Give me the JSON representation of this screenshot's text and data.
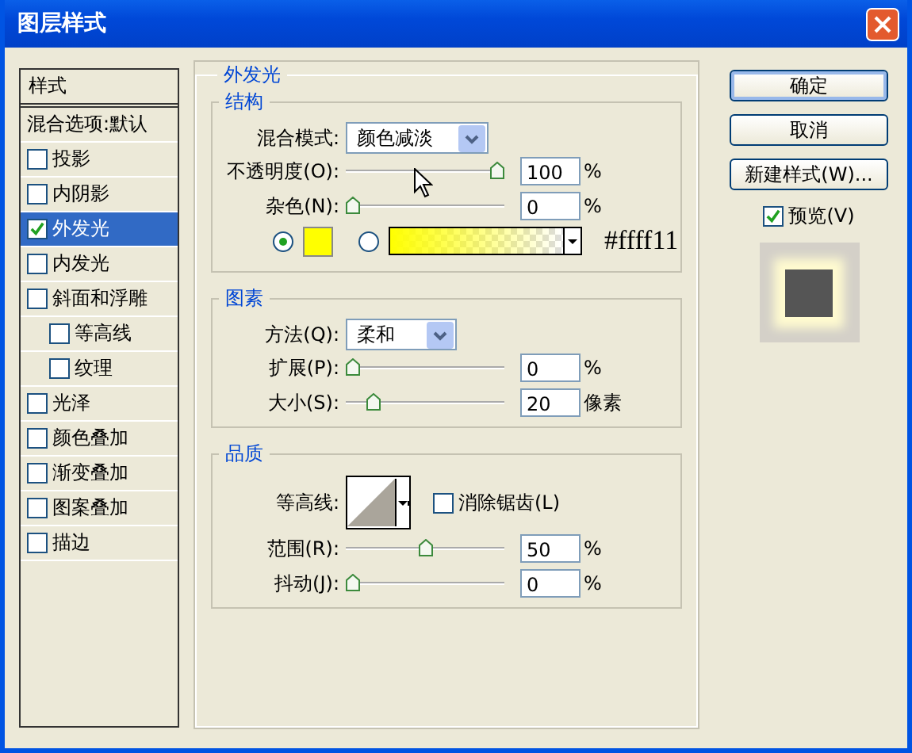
{
  "window": {
    "title": "图层样式"
  },
  "styles_list": {
    "header": "样式",
    "blend_options": "混合选项:默认",
    "items": [
      {
        "label": "投影",
        "checked": false,
        "selected": false
      },
      {
        "label": "内阴影",
        "checked": false,
        "selected": false
      },
      {
        "label": "外发光",
        "checked": true,
        "selected": true
      },
      {
        "label": "内发光",
        "checked": false,
        "selected": false
      },
      {
        "label": "斜面和浮雕",
        "checked": false,
        "selected": false,
        "children": [
          {
            "label": "等高线",
            "checked": false,
            "selected": false
          },
          {
            "label": "纹理",
            "checked": false,
            "selected": false
          }
        ]
      },
      {
        "label": "光泽",
        "checked": false,
        "selected": false
      },
      {
        "label": "颜色叠加",
        "checked": false,
        "selected": false
      },
      {
        "label": "渐变叠加",
        "checked": false,
        "selected": false
      },
      {
        "label": "图案叠加",
        "checked": false,
        "selected": false
      },
      {
        "label": "描边",
        "checked": false,
        "selected": false
      }
    ]
  },
  "outer_glow": {
    "title": "外发光",
    "structure": {
      "title": "结构",
      "blend_mode": {
        "label": "混合模式:",
        "value": "颜色减淡"
      },
      "opacity": {
        "label": "不透明度(O):",
        "level": 1,
        "value": "100",
        "unit": "%"
      },
      "noise": {
        "label": "杂色(N):",
        "level": 0,
        "value": "0",
        "unit": "%"
      },
      "color_modes": [
        {
          "kind": "solid",
          "selected": true,
          "color": "#ffff00"
        },
        {
          "kind": "gradient",
          "selected": false,
          "color": "#ffff00"
        }
      ],
      "annotation": "#ffff11"
    },
    "elements": {
      "title": "图素",
      "technique": {
        "label": "方法(Q):",
        "value": "柔和"
      },
      "spread": {
        "label": "扩展(P):",
        "level": 0,
        "value": "0",
        "unit": "%"
      },
      "size": {
        "label": "大小(S):",
        "level": 0.14,
        "value": "20",
        "unit": "像素"
      }
    },
    "quality": {
      "title": "品质",
      "contour": {
        "label": "等高线:"
      },
      "anti_alias": {
        "label": "消除锯齿(L)",
        "checked": false
      },
      "range": {
        "label": "范围(R):",
        "level": 0.5,
        "value": "50",
        "unit": "%"
      },
      "jitter": {
        "label": "抖动(J):",
        "level": 0,
        "value": "0",
        "unit": "%"
      }
    }
  },
  "buttons": [
    {
      "label": "确定",
      "default": true
    },
    {
      "label": "取消",
      "default": false
    },
    {
      "label": "新建样式(W)...",
      "default": false
    }
  ],
  "preview": {
    "label": "预览(V)",
    "checked": true
  }
}
